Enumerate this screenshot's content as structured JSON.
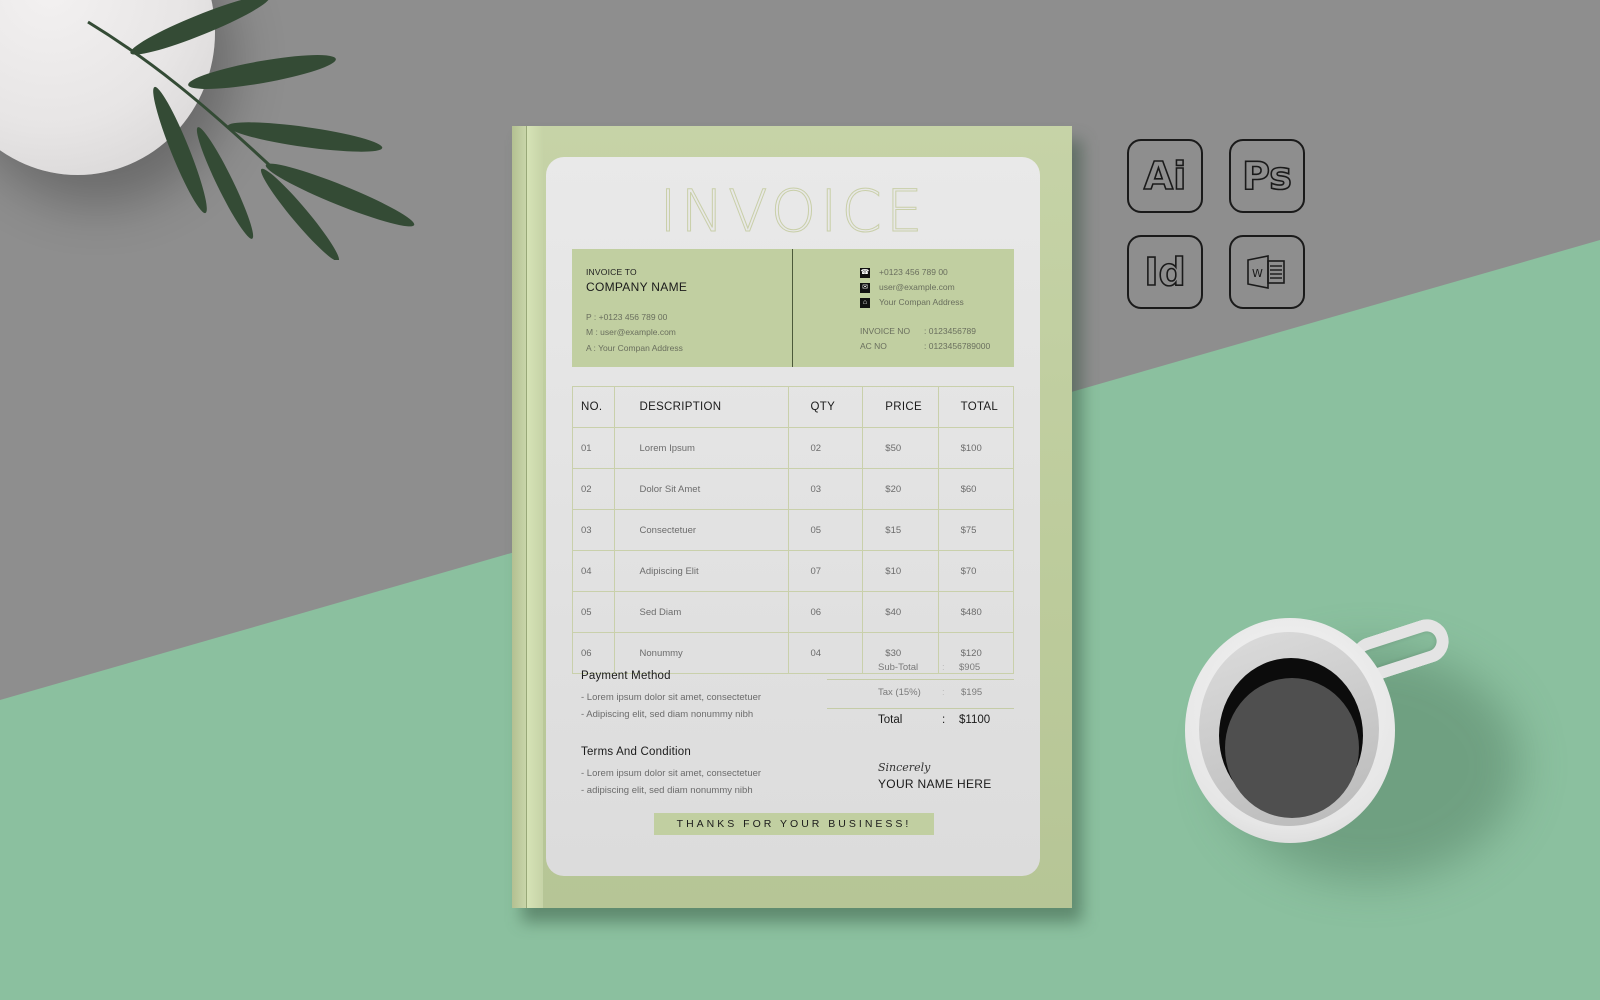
{
  "invoice": {
    "title": "INVOICE",
    "bill_to": {
      "label": "INVOICE TO",
      "company": "COMPANY NAME",
      "phone": "P : +0123 456 789 00",
      "email": "M : user@example.com",
      "address": "A : Your Compan Address"
    },
    "sender": {
      "phone": "+0123 456 789 00",
      "email": "user@example.com",
      "address": "Your Compan Address",
      "invoice_no_label": "INVOICE NO",
      "invoice_no": ": 0123456789",
      "ac_no_label": "AC NO",
      "ac_no": ": 0123456789000"
    },
    "table": {
      "headers": [
        "NO.",
        "DESCRIPTION",
        "QTY",
        "PRICE",
        "TOTAL"
      ],
      "rows": [
        [
          "01",
          "Lorem Ipsum",
          "02",
          "$50",
          "$100"
        ],
        [
          "02",
          "Dolor Sit Amet",
          "03",
          "$20",
          "$60"
        ],
        [
          "03",
          "Consectetuer",
          "05",
          "$15",
          "$75"
        ],
        [
          "04",
          "Adipiscing Elit",
          "07",
          "$10",
          "$70"
        ],
        [
          "05",
          "Sed Diam",
          "06",
          "$40",
          "$480"
        ],
        [
          "06",
          "Nonummy",
          "04",
          "$30",
          "$120"
        ]
      ]
    },
    "payment": {
      "title": "Payment Method",
      "lines": [
        "- Lorem ipsum dolor sit amet, consectetuer",
        "- Adipiscing elit, sed diam nonummy nibh"
      ]
    },
    "terms": {
      "title": "Terms And Condition",
      "lines": [
        "- Lorem ipsum dolor sit amet, consectetuer",
        "- adipiscing elit, sed diam nonummy nibh"
      ]
    },
    "totals": {
      "subtotal_label": "Sub-Total",
      "subtotal": "$905",
      "tax_label": "Tax (15%)",
      "tax": "$195",
      "total_label": "Total",
      "total": "$1100",
      "sep": ":"
    },
    "signoff": "Sincerely",
    "signer": "YOUR NAME HERE",
    "thanks": "THANKS FOR YOUR BUSINESS!"
  },
  "apps": [
    {
      "label": "Ai",
      "icon": "illustrator-icon"
    },
    {
      "label": "Ps",
      "icon": "photoshop-icon"
    },
    {
      "label": "Id",
      "icon": "indesign-icon"
    },
    {
      "label": "W",
      "icon": "word-icon"
    }
  ],
  "icons": {
    "phone": "☎",
    "mail": "✉",
    "home": "⌂"
  },
  "colors": {
    "accent_green": "#c1cfa1",
    "background_grey": "#8e8e8e",
    "background_mint": "#8bc09f"
  }
}
